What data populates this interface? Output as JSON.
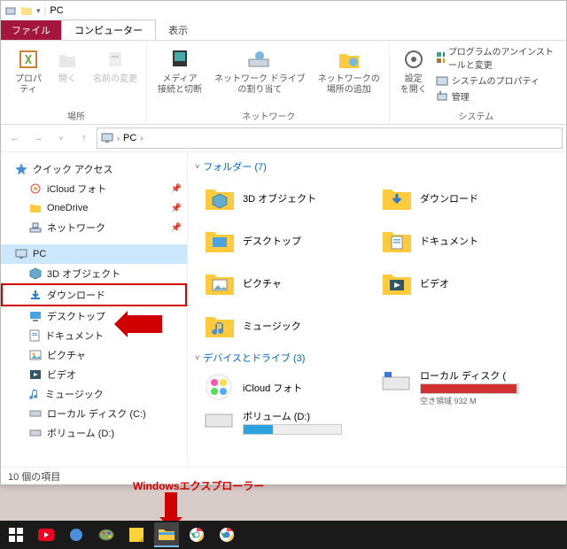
{
  "titlebar": {
    "title": "PC"
  },
  "tabs": {
    "file": "ファイル",
    "computer": "コンピューター",
    "view": "表示"
  },
  "ribbon": {
    "location": {
      "properties": "プロパティ",
      "open": "開く",
      "rename": "名前の変更",
      "group_label": "場所"
    },
    "network": {
      "media": "メディア\n接続と切断",
      "netdrive": "ネットワーク ドライブ\nの割り当て",
      "addnet": "ネットワークの\n場所の追加",
      "group_label": "ネットワーク"
    },
    "system": {
      "settings": "設定\nを開く",
      "uninstall": "プログラムのアンインストールと変更",
      "sysprop": "システムのプロパティ",
      "manage": "管理",
      "group_label": "システム"
    }
  },
  "address": {
    "root": "PC"
  },
  "sidebar": {
    "quick": "クイック アクセス",
    "pinned": [
      {
        "label": "iCloud フォト"
      },
      {
        "label": "OneDrive"
      },
      {
        "label": "ネットワーク"
      }
    ],
    "pc": "PC",
    "pc_children": [
      "3D オブジェクト",
      "ダウンロード",
      "デスクトップ",
      "ドキュメント",
      "ピクチャ",
      "ビデオ",
      "ミュージック",
      "ローカル ディスク (C:)",
      "ボリューム (D:)"
    ]
  },
  "main": {
    "folders_header": "フォルダー (7)",
    "folders": [
      "3D オブジェクト",
      "ダウンロード",
      "デスクトップ",
      "ドキュメント",
      "ピクチャ",
      "ビデオ",
      "ミュージック"
    ],
    "drives_header": "デバイスとドライブ (3)",
    "drives": [
      {
        "label": "iCloud フォト"
      },
      {
        "label": "ローカル ディスク (",
        "sub": "空き領域 932 M",
        "fill": 98,
        "red": true
      },
      {
        "label": "ボリューム (D:)",
        "fill": 30
      }
    ]
  },
  "status": {
    "count": "10 個の項目"
  },
  "annotation": {
    "explorer_label": "Windowsエクスプローラー"
  }
}
